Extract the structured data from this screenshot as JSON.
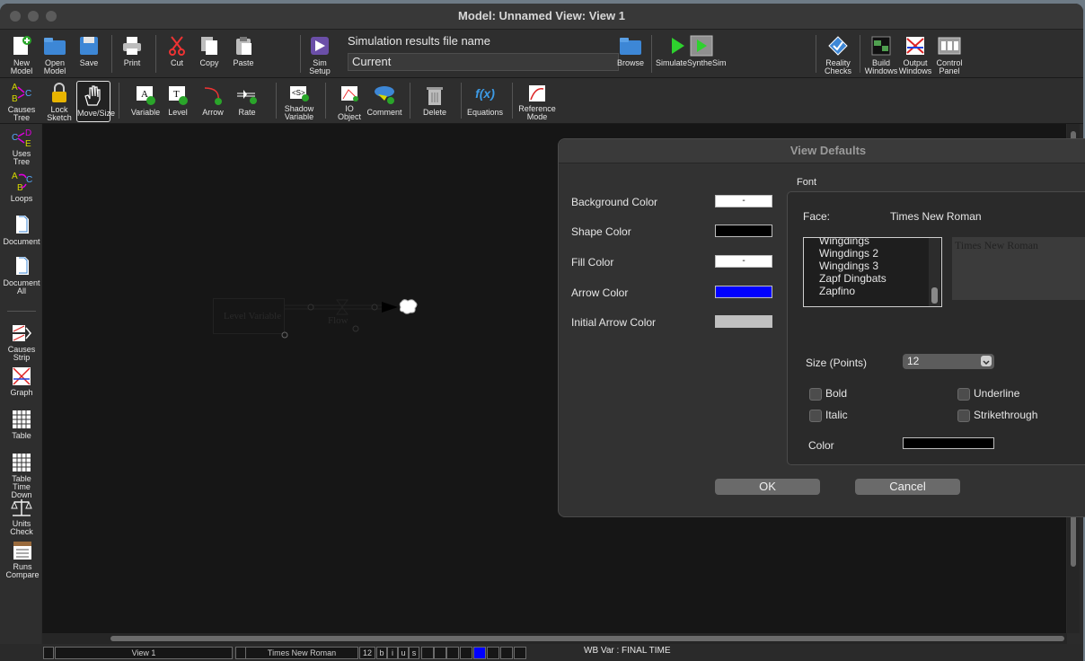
{
  "window": {
    "title": "Model: Unnamed View: View 1"
  },
  "toolbar1": {
    "new_model": "New\nModel",
    "open_model": "Open\nModel",
    "save": "Save",
    "print": "Print",
    "cut": "Cut",
    "copy": "Copy",
    "paste": "Paste",
    "sim_setup": "Sim\nSetup",
    "sim_results_label": "Simulation results file name",
    "sim_results_value": "Current",
    "browse": "Browse",
    "simulate": "SimulateSyntheSim",
    "reality_checks": "Reality\nChecks",
    "build_windows": "Build\nWindows",
    "output_windows": "Output\nWindows",
    "control_panel": "Control\nPanel"
  },
  "toolbar2": {
    "causes_tree": "Causes\nTree",
    "lock_sketch": "Lock\nSketch",
    "move_size": "Move/Size",
    "variable": "Variable",
    "level": "Level",
    "arrow": "Arrow",
    "rate": "Rate",
    "shadow_variable": "Shadow\nVariable",
    "io_object": "IO\nObject",
    "comment": "Comment",
    "delete": "Delete",
    "equations": "Equations",
    "equations_icon": "f(x)",
    "reference_mode": "Reference\nMode"
  },
  "sidebar": {
    "uses_tree": "Uses\nTree",
    "loops": "Loops",
    "document": "Document",
    "document_all": "Document\nAll",
    "causes_strip": "Causes\nStrip",
    "graph": "Graph",
    "table": "Table",
    "table_time_down": "Table\nTime\nDown",
    "units_check": "Units\nCheck",
    "runs_compare": "Runs\nCompare"
  },
  "canvas": {
    "level_variable": "Level Variable",
    "flow": "Flow"
  },
  "statusbar": {
    "view": "View 1",
    "font": "Times New Roman",
    "size": "12",
    "b": "b",
    "i": "i",
    "u": "u",
    "s": "s",
    "wb_var": "WB Var : FINAL TIME"
  },
  "dialog": {
    "title": "View Defaults",
    "background_color": "Background Color",
    "background_swatch": "-",
    "shape_color": "Shape Color",
    "fill_color": "Fill Color",
    "fill_swatch": "-",
    "arrow_color": "Arrow Color",
    "initial_arrow_color": "Initial Arrow Color",
    "font_group": "Font",
    "face_label": "Face:",
    "face_value": "Times New Roman",
    "font_list": [
      "Wingdings",
      "Wingdings 2",
      "Wingdings 3",
      "Zapf Dingbats",
      "Zapfino"
    ],
    "preview": "Times New Roman",
    "size_label": "Size (Points)",
    "size_value": "12",
    "bold": "Bold",
    "underline": "Underline",
    "italic": "Italic",
    "strikethrough": "Strikethrough",
    "color_label": "Color",
    "ok": "OK",
    "cancel": "Cancel"
  },
  "colors": {
    "shape_color": "#000000",
    "arrow_color": "#0000ff",
    "initial_arrow_color": "#c0c0c0",
    "background_color": "#ffffff",
    "fill_color": "#ffffff",
    "font_color": "#000000"
  }
}
